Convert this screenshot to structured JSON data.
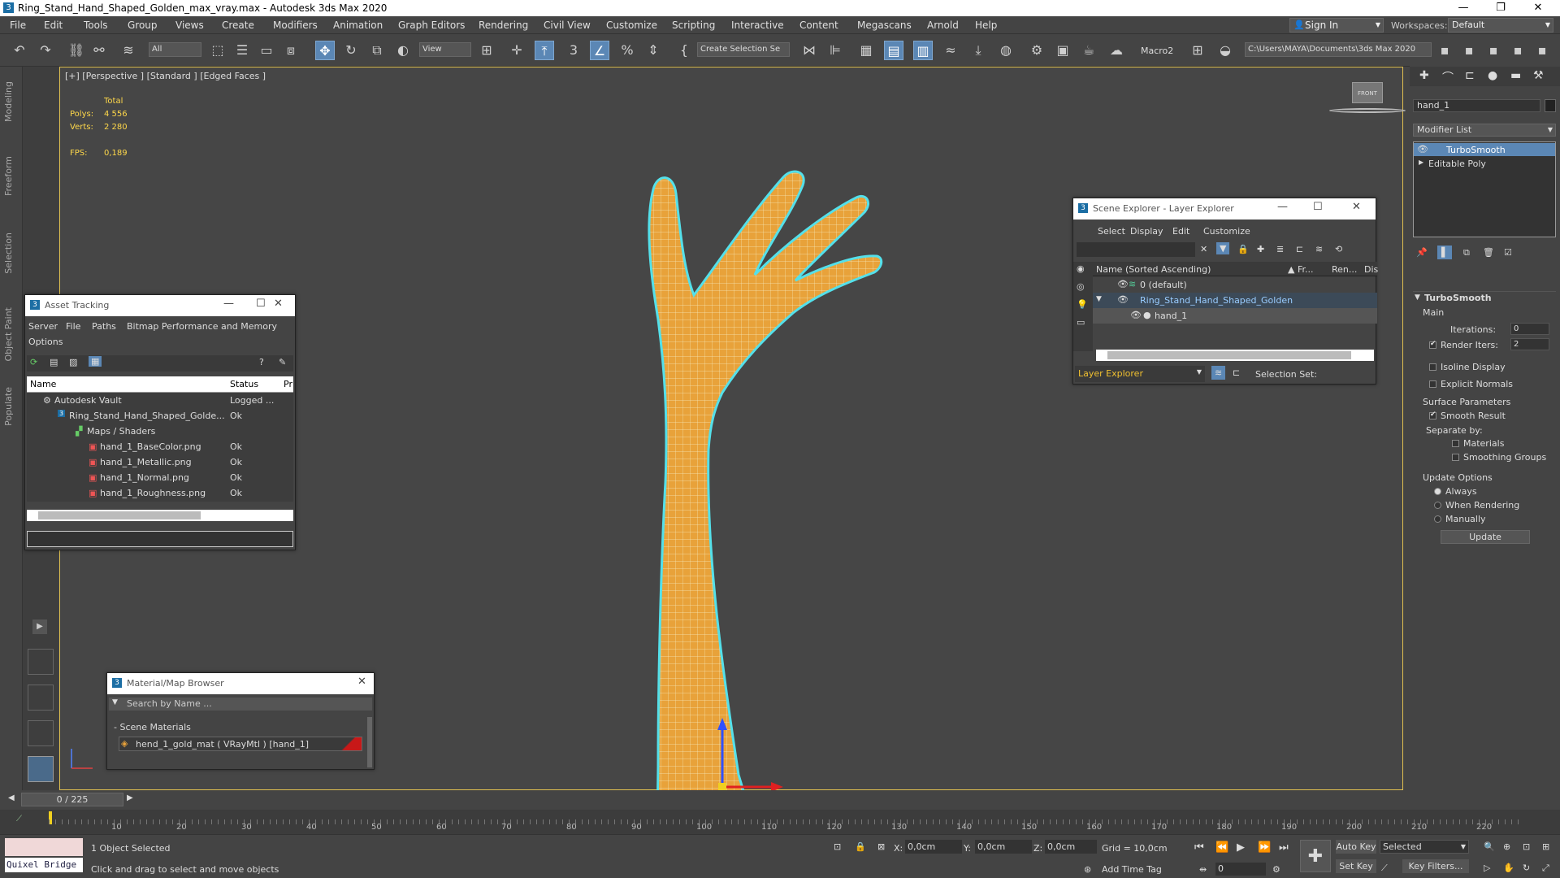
{
  "window": {
    "title": "Ring_Stand_Hand_Shaped_Golden_max_vray.max - Autodesk 3ds Max 2020",
    "minimize": "—",
    "maximize": "❐",
    "close": "✕"
  },
  "menu": [
    "File",
    "Edit",
    "Tools",
    "Group",
    "Views",
    "Create",
    "Modifiers",
    "Animation",
    "Graph Editors",
    "Rendering",
    "Civil View",
    "Customize",
    "Scripting",
    "Interactive",
    "Content",
    "Megascans",
    "Arnold",
    "Help"
  ],
  "account": {
    "sign_in": "Sign In",
    "workspaces_label": "Workspaces:",
    "workspace": "Default"
  },
  "toolbar": {
    "filter": "All",
    "ref_coord": "View",
    "selection_set": "Create Selection Se",
    "macro": "Macro2",
    "project_path": "C:\\Users\\MAYA\\Documents\\3ds Max 2020"
  },
  "left_tabs": [
    "Modeling",
    "Freeform",
    "Selection",
    "Object Paint",
    "Populate"
  ],
  "viewport": {
    "label": "[+] [Perspective ] [Standard ] [Edged Faces ]",
    "stats": {
      "total_label": "Total",
      "polys_label": "Polys:",
      "polys": "4 556",
      "verts_label": "Verts:",
      "verts": "2 280",
      "fps_label": "FPS:",
      "fps": "0,189"
    },
    "viewcube": "FRONT",
    "colors": {
      "mesh": "#e8a23a",
      "selection_outline": "#54e0ea",
      "wire": "#f6e9b8"
    }
  },
  "asset_tracking": {
    "title": "Asset Tracking",
    "menu": [
      "Server",
      "File",
      "Paths",
      "Bitmap Performance and Memory",
      "Options"
    ],
    "columns": [
      "Name",
      "Status",
      "Pr"
    ],
    "rows": [
      {
        "name": "Autodesk Vault",
        "status": "Logged ..."
      },
      {
        "name": "Ring_Stand_Hand_Shaped_Golde...",
        "status": "Ok"
      },
      {
        "name": "Maps / Shaders",
        "status": ""
      },
      {
        "name": "hand_1_BaseColor.png",
        "status": "Ok"
      },
      {
        "name": "hand_1_Metallic.png",
        "status": "Ok"
      },
      {
        "name": "hand_1_Normal.png",
        "status": "Ok"
      },
      {
        "name": "hand_1_Roughness.png",
        "status": "Ok"
      }
    ]
  },
  "material_browser": {
    "title": "Material/Map Browser",
    "search_placeholder": "Search by Name ...",
    "section": "- Scene Materials",
    "material": "hend_1_gold_mat  ( VRayMtl ) [hand_1]"
  },
  "scene_explorer": {
    "title": "Scene Explorer - Layer Explorer",
    "menu": [
      "Select",
      "Display",
      "Edit",
      "Customize"
    ],
    "columns": [
      "Name (Sorted Ascending)",
      "▲ Fr...",
      "Ren...",
      "Dis"
    ],
    "rows": [
      {
        "name": "0 (default)"
      },
      {
        "name": "Ring_Stand_Hand_Shaped_Golden"
      },
      {
        "name": "hand_1"
      }
    ],
    "footer_mode": "Layer Explorer",
    "selection_set_label": "Selection Set:"
  },
  "command_panel": {
    "object_name": "hand_1",
    "modifier_list": "Modifier List",
    "stack": [
      "TurboSmooth",
      "Editable Poly"
    ],
    "rollout_title": "TurboSmooth",
    "main_label": "Main",
    "iterations_label": "Iterations:",
    "iterations": "0",
    "render_iters_label": "Render Iters:",
    "render_iters": "2",
    "isoline": "Isoline Display",
    "explicit_normals": "Explicit Normals",
    "surface_params": "Surface Parameters",
    "smooth_result": "Smooth Result",
    "separate_by": "Separate by:",
    "materials": "Materials",
    "smoothing_groups": "Smoothing Groups",
    "update_options": "Update Options",
    "always": "Always",
    "when_rendering": "When Rendering",
    "manually": "Manually",
    "update_btn": "Update"
  },
  "timeline": {
    "frame": "0 / 225",
    "ticks": [
      "10",
      "20",
      "30",
      "40",
      "50",
      "60",
      "70",
      "80",
      "90",
      "100",
      "110",
      "120",
      "130",
      "140",
      "150",
      "160",
      "170",
      "180",
      "190",
      "200",
      "210",
      "220"
    ]
  },
  "status": {
    "quixel": "Quixel Bridge",
    "selected": "1 Object Selected",
    "prompt": "Click and drag to select and move objects",
    "x_label": "X:",
    "x": "0,0cm",
    "y_label": "Y:",
    "y": "0,0cm",
    "z_label": "Z:",
    "z": "0,0cm",
    "grid": "Grid = 10,0cm",
    "add_time_tag": "Add Time Tag",
    "auto_key": "Auto Key",
    "set_key": "Set Key",
    "key_mode": "Selected",
    "key_filters": "Key Filters...",
    "current_frame": "0"
  }
}
